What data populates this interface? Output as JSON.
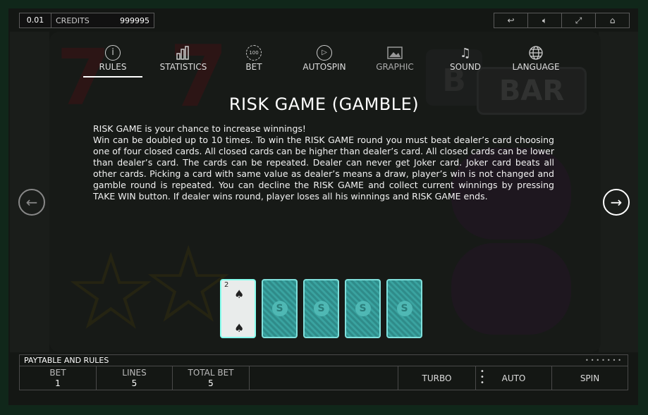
{
  "topbar": {
    "bet": "0.01",
    "credits_label": "CREDITS",
    "credits_value": "999995"
  },
  "system_buttons": [
    "back-icon",
    "sound-icon",
    "fullscreen-icon",
    "home-icon"
  ],
  "tabs": [
    {
      "label": "RULES",
      "icon": "info-icon",
      "active": true
    },
    {
      "label": "STATISTICS",
      "icon": "bar-chart-icon"
    },
    {
      "label": "BET",
      "icon": "chip-icon"
    },
    {
      "label": "AUTOSPIN",
      "icon": "play-gear-icon"
    },
    {
      "label": "GRAPHIC",
      "icon": "image-icon"
    },
    {
      "label": "SOUND",
      "icon": "music-note-icon"
    },
    {
      "label": "LANGUAGE",
      "icon": "globe-icon"
    }
  ],
  "content": {
    "title": "RISK GAME (GAMBLE)",
    "line1": "RISK GAME is your chance to increase winnings!",
    "line2": "Win can be doubled up to 10 times. To win the RISK GAME round you must beat dealer’s card choosing one of four closed cards. All closed cards can be higher than dealer’s card. All closed cards can be lower than dealer’s card. The cards can be repeated. Dealer can never get Joker card. Joker card beats all other cards. Picking a card with same value as dealer’s means a draw, player’s win is not changed and gamble round is repeated. You can decline the RISK GAME and collect current winnings by pressing TAKE WIN button. If dealer wins round, player loses all his winnings and RISK GAME ends."
  },
  "cards": {
    "dealer_rank": "2",
    "dealer_suit": "♠",
    "back_logo": "S",
    "closed_count": 4
  },
  "bottom": {
    "paytable_label": "PAYTABLE AND RULES",
    "bet_label": "BET",
    "bet_value": "1",
    "lines_label": "LINES",
    "lines_value": "5",
    "total_bet_label": "TOTAL BET",
    "total_bet_value": "5",
    "turbo": "TURBO",
    "auto": "AUTO",
    "spin": "SPIN"
  }
}
